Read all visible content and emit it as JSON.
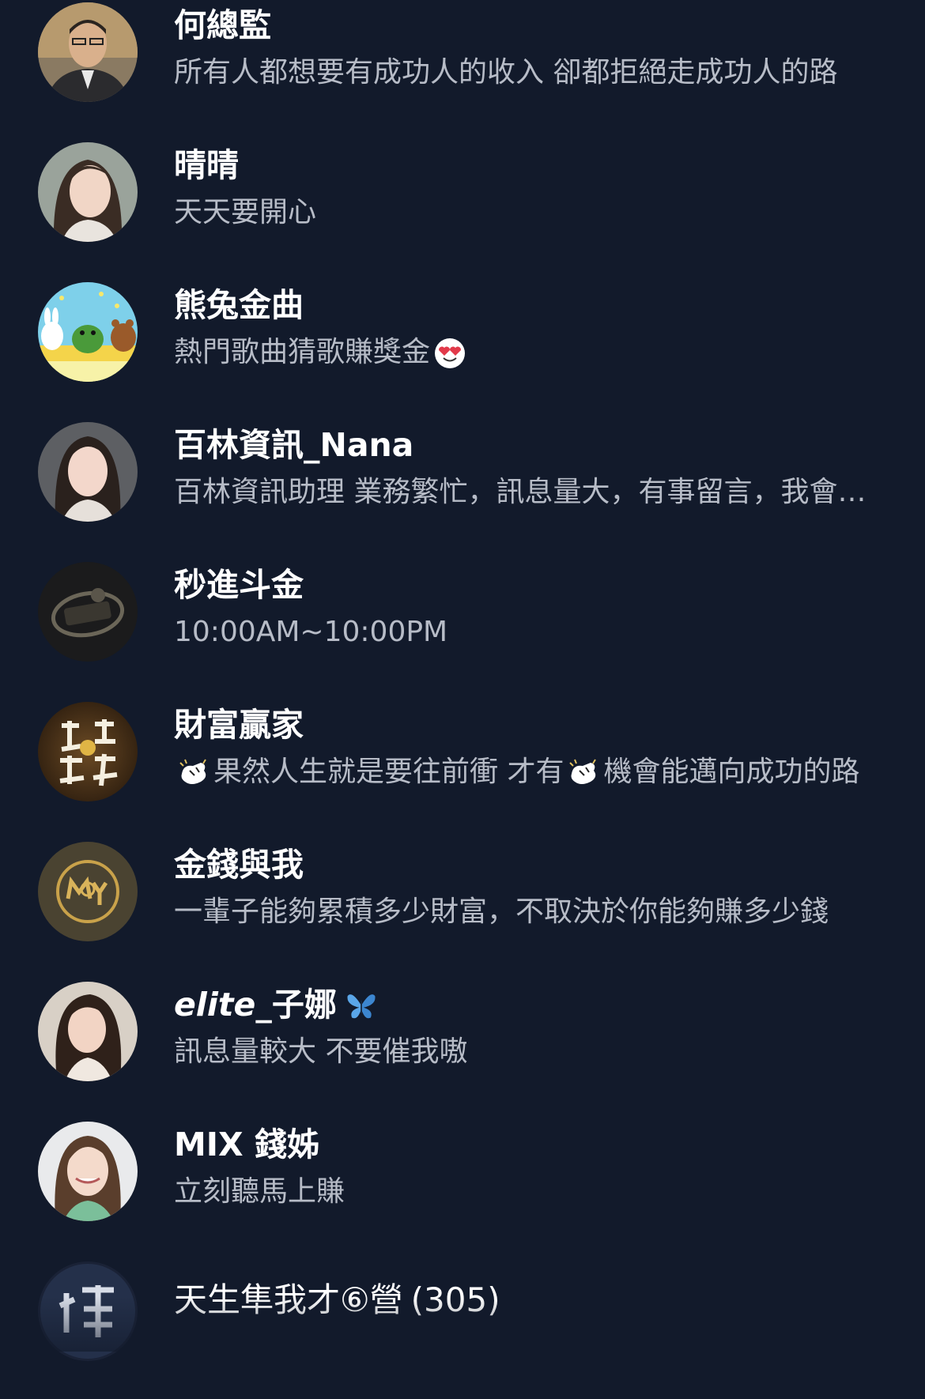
{
  "colors": {
    "background": "#121a2b",
    "name_text": "#ffffff",
    "status_text": "#b7bcc7"
  },
  "friends": [
    {
      "name": "何總監",
      "status": "所有人都想要有成功人的收入 卻都拒絕走成功人的路",
      "avatar": "avatar-man-icon"
    },
    {
      "name": "晴晴",
      "status": "天天要開心",
      "avatar": "avatar-woman-icon"
    },
    {
      "name": "熊兔金曲",
      "status": "熱門歌曲猜歌賺獎金",
      "status_emoji": "heart-eyes-emoji-icon",
      "avatar": "cartoon-bears-icon"
    },
    {
      "name": "百林資訊_Nana",
      "status": "百林資訊助理 業務繁忙，訊息量大，有事留言，我會回覆",
      "avatar": "avatar-woman-icon"
    },
    {
      "name": "秒進斗金",
      "status": "10:00AM~10:00PM",
      "avatar": "badge-logo-icon"
    },
    {
      "name": "財富贏家",
      "status_parts": [
        "果然人生就是要往前衝 才有",
        "機會能邁向成功的路"
      ],
      "status_emoji": "flexing-hand-emoji-icon",
      "avatar": "calligraphy-logo-icon"
    },
    {
      "name": "金錢與我",
      "status": "一輩子能夠累積多少財富，不取決於你能夠賺多少錢",
      "avatar": "money-logo-icon"
    },
    {
      "name_italic": "elite",
      "name_rest": "_子娜",
      "name_emoji": "butterfly-emoji-icon",
      "status": "訊息量較大 不要催我嗷",
      "avatar": "avatar-woman-icon"
    },
    {
      "name": "MIX 錢姊",
      "status": "立刻聽馬上賺",
      "avatar": "avatar-woman-icon"
    }
  ],
  "group": {
    "name": "天生隼我才⑥營",
    "count": "(305)",
    "avatar": "group-logo-icon"
  }
}
